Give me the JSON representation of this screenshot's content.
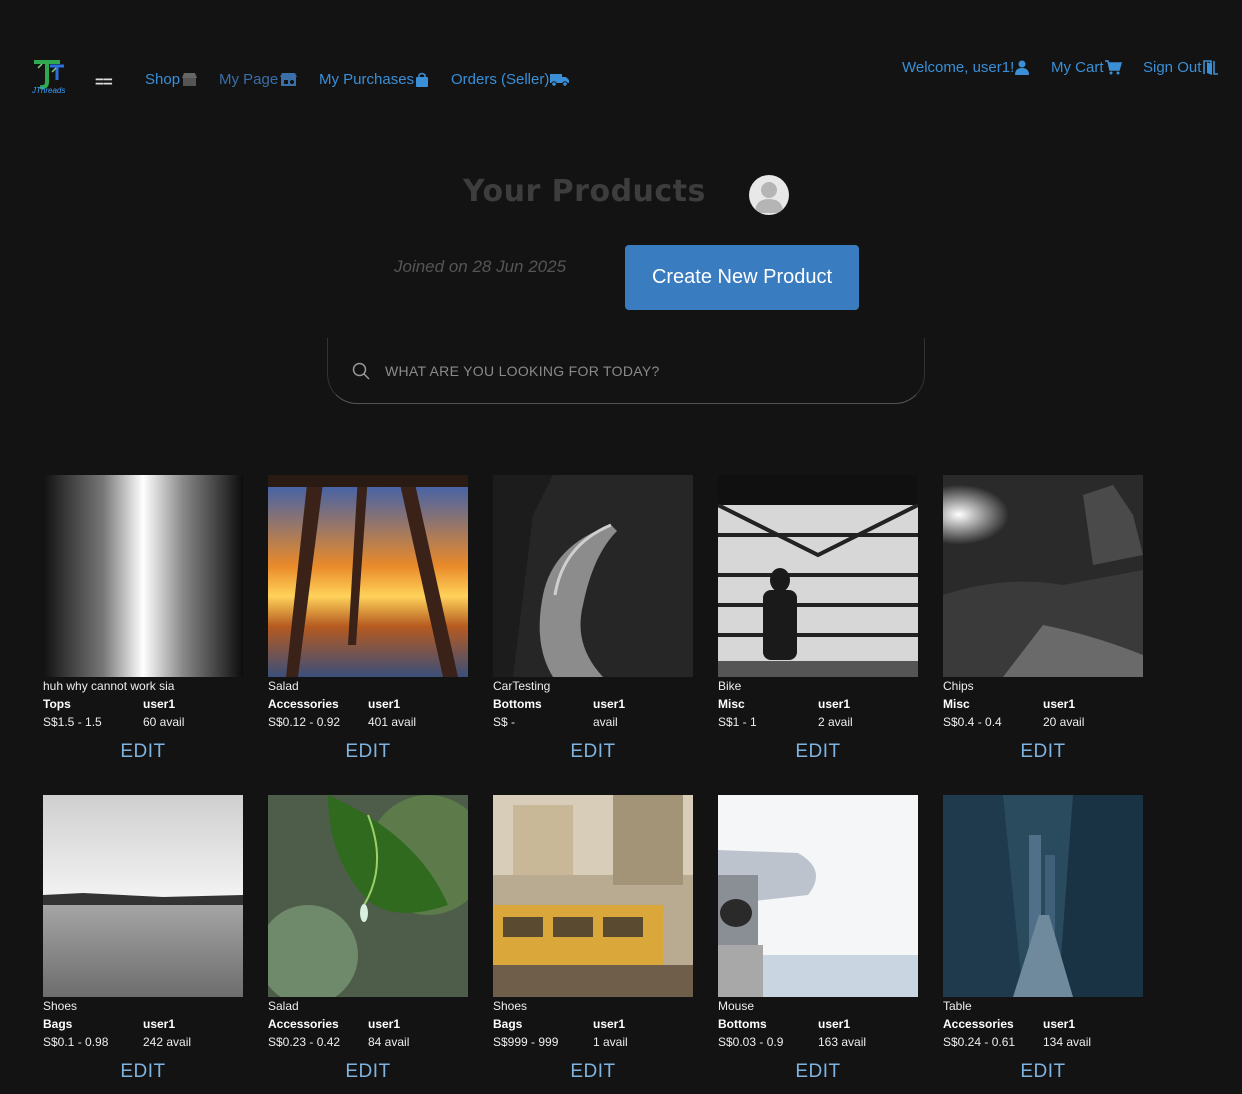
{
  "nav": {
    "logo_text": "JThreads",
    "menu_toggle": "==",
    "shop": "Shop",
    "my_page": "My Page",
    "my_purchases": "My Purchases",
    "orders_seller": "Orders (Seller)",
    "welcome": "Welcome, user1!",
    "my_cart": "My Cart",
    "sign_out": "Sign Out"
  },
  "header": {
    "title": "Your Products",
    "joined": "Joined on 28 Jun 2025",
    "create_button": "Create New Product"
  },
  "search": {
    "placeholder": "What are you looking for today?",
    "value": ""
  },
  "products": [
    {
      "name": "huh why cannot work sia",
      "category": "Tops",
      "seller": "user1",
      "price": "S$1.5 - 1.5",
      "avail": "60 avail",
      "edit": "EDIT",
      "image": "metallic-gradient"
    },
    {
      "name": "Salad",
      "category": "Accessories",
      "seller": "user1",
      "price": "S$0.12 - 0.92",
      "avail": "401 avail",
      "edit": "EDIT",
      "image": "pier-sunset"
    },
    {
      "name": "CarTesting",
      "category": "Bottoms",
      "seller": "user1",
      "price": "S$ -",
      "avail": "avail",
      "edit": "EDIT",
      "image": "dark-road"
    },
    {
      "name": "Bike",
      "category": "Misc",
      "seller": "user1",
      "price": "S$1 - 1",
      "avail": "2 avail",
      "edit": "EDIT",
      "image": "silhouette-window"
    },
    {
      "name": "Chips",
      "category": "Misc",
      "seller": "user1",
      "price": "S$0.4 - 0.4",
      "avail": "20 avail",
      "edit": "EDIT",
      "image": "night-rocks"
    },
    {
      "name": "Shoes",
      "category": "Bags",
      "seller": "user1",
      "price": "S$0.1 - 0.98",
      "avail": "242 avail",
      "edit": "EDIT",
      "image": "grey-lake"
    },
    {
      "name": "Salad",
      "category": "Accessories",
      "seller": "user1",
      "price": "S$0.23 - 0.42",
      "avail": "84 avail",
      "edit": "EDIT",
      "image": "green-leaf"
    },
    {
      "name": "Shoes",
      "category": "Bags",
      "seller": "user1",
      "price": "S$999 - 999",
      "avail": "1 avail",
      "edit": "EDIT",
      "image": "yellow-tram"
    },
    {
      "name": "Mouse",
      "category": "Bottoms",
      "seller": "user1",
      "price": "S$0.03 - 0.9",
      "avail": "163 avail",
      "edit": "EDIT",
      "image": "binocular-viewer"
    },
    {
      "name": "Table",
      "category": "Accessories",
      "seller": "user1",
      "price": "S$0.24 - 0.61",
      "avail": "134 avail",
      "edit": "EDIT",
      "image": "city-street"
    }
  ]
}
